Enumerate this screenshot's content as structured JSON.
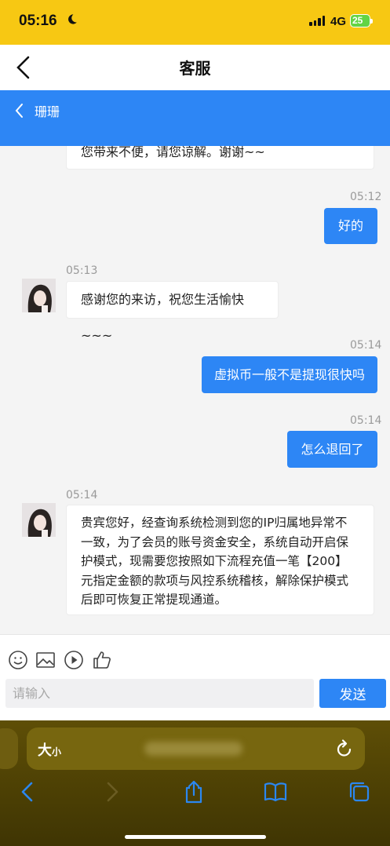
{
  "status_bar": {
    "time": "05:16",
    "network": "4G",
    "battery": "25"
  },
  "nav": {
    "title": "客服"
  },
  "chat_header": {
    "contact_name": "珊珊"
  },
  "messages": [
    {
      "side": "in",
      "lines": [
        "您带来不便，请您谅解。谢谢~~"
      ]
    },
    {
      "side": "out",
      "time": "05:12",
      "lines": [
        "好的"
      ]
    },
    {
      "side": "in",
      "time": "05:13",
      "lines": [
        "感谢您的来访，祝您生活愉快~~~"
      ]
    },
    {
      "side": "out",
      "time": "05:14",
      "lines": [
        "虚拟币一般不是提现很快吗"
      ]
    },
    {
      "side": "out",
      "time": "05:14",
      "lines": [
        "怎么退回了"
      ]
    },
    {
      "side": "in",
      "time": "05:14",
      "lines": [
        "贵宾您好，经查询系统检测到您的IP归属地异常不",
        "一致，为了会员的账号资金安全，系统自动开启保",
        "护模式，现需要您按照如下流程充值一笔【200】",
        "元指定金额的款项与风控系统稽核，解除保护模式",
        "后即可恢复正常提现通道。"
      ]
    }
  ],
  "composer": {
    "placeholder": "请输入",
    "send_label": "发送",
    "tools": [
      "emoji-icon",
      "image-icon",
      "video-icon",
      "thumbs-up-icon"
    ]
  },
  "browser": {
    "text_size_label": "大",
    "text_size_small": "小",
    "buttons": [
      "back-icon",
      "forward-icon",
      "share-icon",
      "bookmarks-icon",
      "tabs-icon"
    ]
  },
  "colors": {
    "accent": "#2d86f5",
    "status_bar": "#f7c813"
  }
}
